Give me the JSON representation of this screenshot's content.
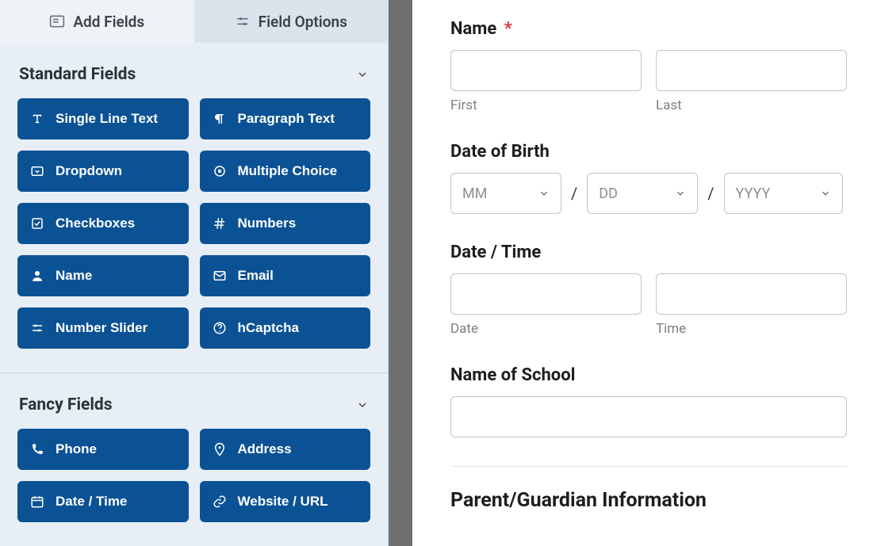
{
  "tabs": {
    "add_fields": "Add Fields",
    "field_options": "Field Options"
  },
  "sections": {
    "standard": {
      "title": "Standard Fields",
      "fields": [
        {
          "label": "Single Line Text",
          "icon": "text"
        },
        {
          "label": "Paragraph Text",
          "icon": "paragraph"
        },
        {
          "label": "Dropdown",
          "icon": "dropdown"
        },
        {
          "label": "Multiple Choice",
          "icon": "radio"
        },
        {
          "label": "Checkboxes",
          "icon": "checkbox"
        },
        {
          "label": "Numbers",
          "icon": "hash"
        },
        {
          "label": "Name",
          "icon": "user"
        },
        {
          "label": "Email",
          "icon": "envelope"
        },
        {
          "label": "Number Slider",
          "icon": "slider"
        },
        {
          "label": "hCaptcha",
          "icon": "question"
        }
      ]
    },
    "fancy": {
      "title": "Fancy Fields",
      "fields": [
        {
          "label": "Phone",
          "icon": "phone"
        },
        {
          "label": "Address",
          "icon": "pin"
        },
        {
          "label": "Date / Time",
          "icon": "calendar"
        },
        {
          "label": "Website / URL",
          "icon": "link"
        }
      ]
    }
  },
  "form": {
    "name": {
      "label": "Name",
      "required": "*",
      "first": "First",
      "last": "Last"
    },
    "dob": {
      "label": "Date of Birth",
      "mm": "MM",
      "dd": "DD",
      "yyyy": "YYYY",
      "sep": "/"
    },
    "datetime": {
      "label": "Date / Time",
      "date": "Date",
      "time": "Time"
    },
    "school": {
      "label": "Name of School"
    },
    "guardian_heading": "Parent/Guardian Information"
  }
}
